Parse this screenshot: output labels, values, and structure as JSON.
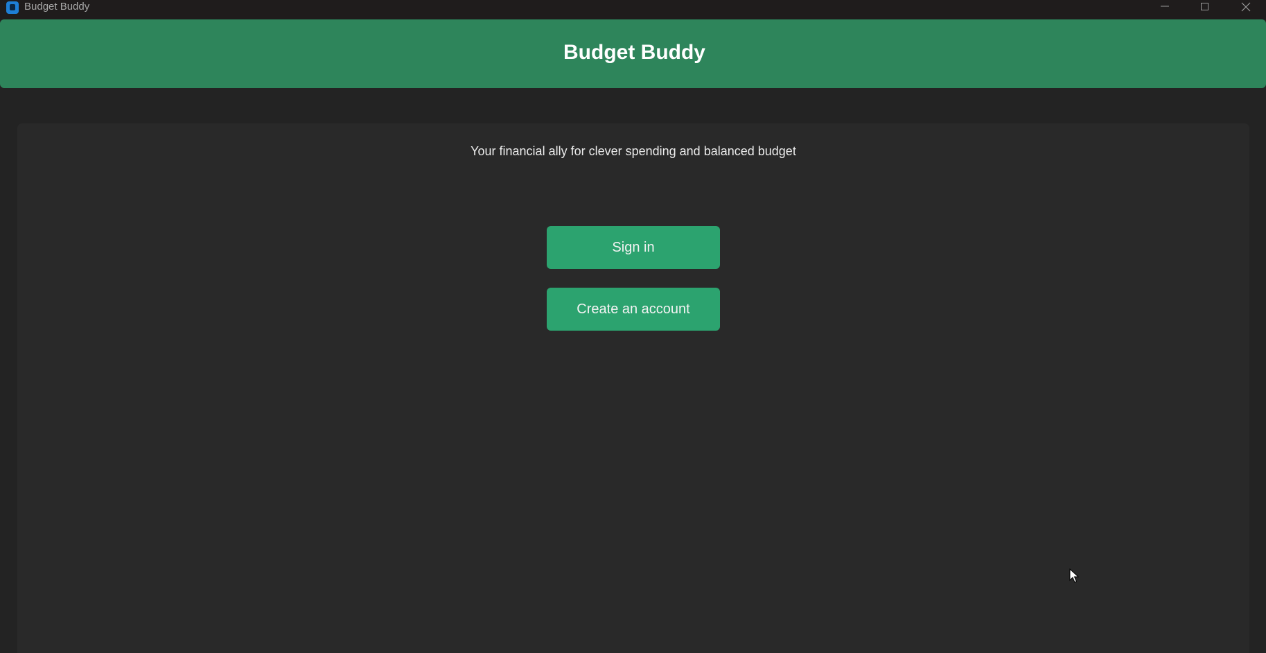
{
  "window": {
    "title": "Budget Buddy",
    "app_icon": "app-icon",
    "controls": [
      "minimize-icon",
      "maximize-icon",
      "close-icon"
    ]
  },
  "header": {
    "title": "Budget Buddy"
  },
  "main": {
    "tagline": "Your financial ally for clever spending and balanced budget",
    "sign_in_label": "Sign in",
    "create_account_label": "Create an account"
  },
  "colors": {
    "header_bg": "#2e855b",
    "button_bg": "#2ca36f",
    "panel_bg": "#292929",
    "window_bg": "#232323",
    "titlebar_bg": "#1f1c1c"
  }
}
